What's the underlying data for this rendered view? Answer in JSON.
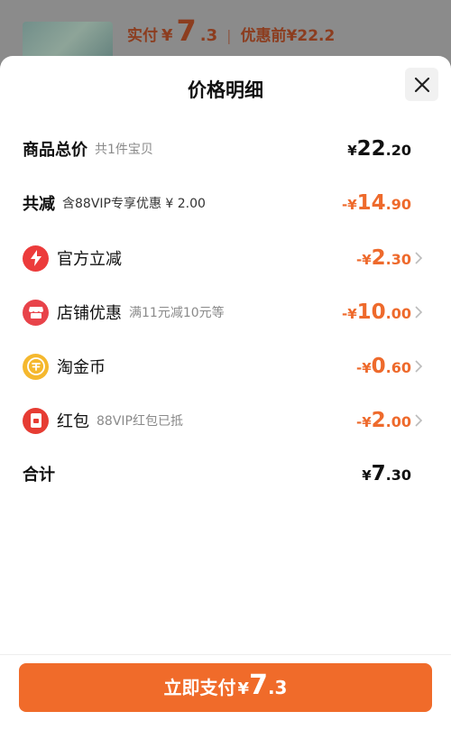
{
  "background": {
    "pay_label": "实付",
    "currency": "¥",
    "pay_int": "7",
    "pay_dec": ".3",
    "separator": "|",
    "original_label": "优惠前¥22.2"
  },
  "sheet": {
    "title": "价格明细",
    "close_icon": "close-icon"
  },
  "rows": [
    {
      "label": "商品总价",
      "sub": "共1件宝贝",
      "prefix": "¥",
      "int": "22",
      "dec": ".20",
      "color": "#111111"
    },
    {
      "label": "共减",
      "sub": "含88VIP专享优惠 ¥ 2.00",
      "prefix": "-¥",
      "int": "14",
      "dec": ".90",
      "color": "#ee6a2c"
    },
    {
      "label": "官方立减",
      "icon": "lightning-icon",
      "prefix": "-¥",
      "int": "2",
      "dec": ".30",
      "color": "#ee6a2c"
    },
    {
      "label": "店铺优惠",
      "sub": "满11元减10元等",
      "icon": "shop-icon",
      "prefix": "-¥",
      "int": "10",
      "dec": ".00",
      "color": "#ee6a2c"
    },
    {
      "label": "淘金币",
      "icon": "coin-icon",
      "prefix": "-¥",
      "int": "0",
      "dec": ".60",
      "color": "#ee6a2c"
    },
    {
      "label": "红包",
      "sub": "88VIP红包已抵",
      "icon": "red-packet-icon",
      "prefix": "-¥",
      "int": "2",
      "dec": ".00",
      "color": "#ee6a2c"
    },
    {
      "label": "合计",
      "prefix": "¥",
      "int": "7",
      "dec": ".30",
      "color": "#111111"
    }
  ],
  "pay_button": {
    "label": "立即支付",
    "currency": "¥",
    "int": "7",
    "dec": ".3",
    "color": "#f06b2a"
  }
}
